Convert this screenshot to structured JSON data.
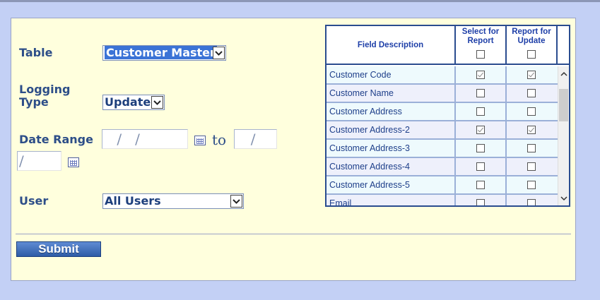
{
  "form": {
    "table_label": "Table",
    "table_value": "Customer Master",
    "logging_label_line1": "Logging",
    "logging_label_line2": "Type",
    "logging_value": "Update",
    "date_range_label": "Date Range",
    "date_from_text": " /   /",
    "date_to_label": "to",
    "date_to_text": "  /",
    "date_to_text2": "/",
    "user_label": "User",
    "user_value": "All Users",
    "submit_label": "Submit"
  },
  "grid": {
    "headers": {
      "field_description": "Field Description",
      "select_for_report_1": "Select for",
      "select_for_report_2": "Report",
      "report_for_update_1": "Report for",
      "report_for_update_2": "Update"
    },
    "rows": [
      {
        "field": "Customer Code",
        "select": true,
        "update": true
      },
      {
        "field": "Customer Name",
        "select": false,
        "update": false
      },
      {
        "field": "Customer Address",
        "select": false,
        "update": false
      },
      {
        "field": "Customer Address-2",
        "select": true,
        "update": true
      },
      {
        "field": "Customer Address-3",
        "select": false,
        "update": false
      },
      {
        "field": "Customer Address-4",
        "select": false,
        "update": false
      },
      {
        "field": "Customer Address-5",
        "select": false,
        "update": false
      },
      {
        "field": "Email",
        "select": false,
        "update": false
      }
    ]
  },
  "colors": {
    "background": "#c3d0f5",
    "panel": "#ffffdd",
    "accent": "#2d4e88",
    "row_alt_a": "#eefafd",
    "row_alt_b": "#eef0fb"
  }
}
